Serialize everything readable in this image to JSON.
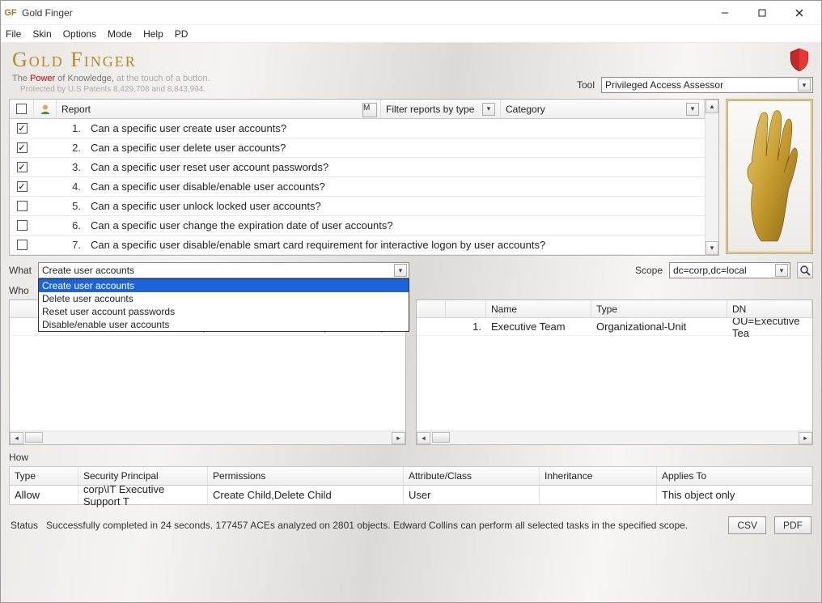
{
  "window": {
    "icon_text": "GF",
    "title": "Gold Finger"
  },
  "menu": [
    "File",
    "Skin",
    "Options",
    "Mode",
    "Help",
    "PD"
  ],
  "brand": {
    "title": "Gold Finger",
    "tagline_pre": "The ",
    "tagline_power": "Power",
    "tagline_mid": " of Knowledge,",
    "tagline_suffix": " at the touch of a button.",
    "patents": "Protected by U.S Patents 8,429,708 and 8,843,994."
  },
  "tool": {
    "label": "Tool",
    "value": "Privileged Access Assessor"
  },
  "report_list": {
    "headers": {
      "report": "Report",
      "m": "M",
      "filter": "Filter reports by type",
      "category": "Category"
    },
    "rows": [
      {
        "checked": true,
        "num": "1.",
        "text": "Can a specific user create user accounts?"
      },
      {
        "checked": true,
        "num": "2.",
        "text": "Can a specific user delete user accounts?"
      },
      {
        "checked": true,
        "num": "3.",
        "text": "Can a specific user reset user account passwords?"
      },
      {
        "checked": true,
        "num": "4.",
        "text": "Can a specific user disable/enable user accounts?"
      },
      {
        "checked": false,
        "num": "5.",
        "text": "Can a specific user unlock locked user accounts?"
      },
      {
        "checked": false,
        "num": "6.",
        "text": "Can a specific user change the expiration date of user accounts?"
      },
      {
        "checked": false,
        "num": "7.",
        "text": "Can a specific user disable/enable smart card requirement for interactive logon by user accounts?"
      }
    ]
  },
  "what": {
    "label": "What",
    "value": "Create user accounts",
    "options": [
      "Create user accounts",
      "Delete user accounts",
      "Reset user account passwords",
      "Disable/enable user accounts"
    ],
    "selected_index": 0
  },
  "scope": {
    "label": "Scope",
    "value": "dc=corp,dc=local"
  },
  "who": {
    "label": "Who",
    "left": {
      "headers": {
        "num": "",
        "name": "",
        "account": "",
        "title": ""
      },
      "row": {
        "num": "1.",
        "name": "Edward Collins",
        "account": "corp\\EdwardCollins",
        "title": "Systems Analyst"
      }
    },
    "right": {
      "headers": {
        "num": "",
        "name": "Name",
        "type": "Type",
        "dn": "DN"
      },
      "row": {
        "num": "1.",
        "name": "Executive Team",
        "type": "Organizational-Unit",
        "dn": "OU=Executive Tea"
      }
    }
  },
  "how": {
    "label": "How",
    "headers": {
      "type": "Type",
      "principal": "Security Principal",
      "permissions": "Permissions",
      "attrclass": "Attribute/Class",
      "inheritance": "Inheritance",
      "applies": "Applies To"
    },
    "row": {
      "type": "Allow",
      "principal": "corp\\IT Executive Support T",
      "permissions": "Create Child,Delete Child",
      "attrclass": "User",
      "inheritance": "",
      "applies": "This object only"
    }
  },
  "status": {
    "label": "Status",
    "text": "Successfully completed in 24 seconds.  177457 ACEs analyzed on 2801 objects.  Edward Collins can perform all selected tasks in the specified scope."
  },
  "buttons": {
    "csv": "CSV",
    "pdf": "PDF"
  },
  "icons": {
    "check": "✓",
    "down": "▾",
    "up": "▴",
    "left": "◂",
    "right": "▸",
    "search": "🔍"
  }
}
